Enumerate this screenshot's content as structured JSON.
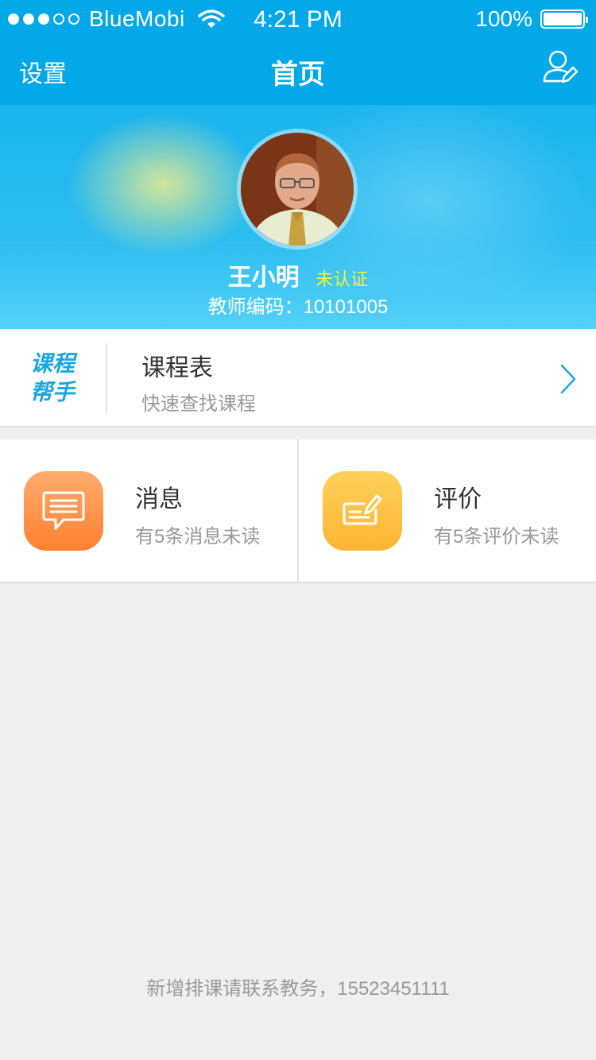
{
  "status": {
    "carrier": "BlueMobi",
    "time": "4:21 PM",
    "battery": "100%"
  },
  "nav": {
    "left_label": "设置",
    "title": "首页",
    "right_icon": "user-edit-icon"
  },
  "profile": {
    "name": "王小明",
    "verification": "未认证",
    "teacher_code": "教师编码：10101005"
  },
  "course": {
    "logo_line1": "课程",
    "logo_line2": "帮手",
    "title": "课程表",
    "subtitle": "快速查找课程"
  },
  "tiles": [
    {
      "title": "消息",
      "subtitle": "有5条消息未读",
      "icon": "message-icon"
    },
    {
      "title": "评价",
      "subtitle": "有5条评价未读",
      "icon": "evaluation-icon"
    }
  ],
  "footer": "新增排课请联系教务，15523451111",
  "colors": {
    "primary": "#03a8e8",
    "badge": "#f3f72a",
    "message": "#fc8130",
    "evaluation": "#fdb534"
  }
}
